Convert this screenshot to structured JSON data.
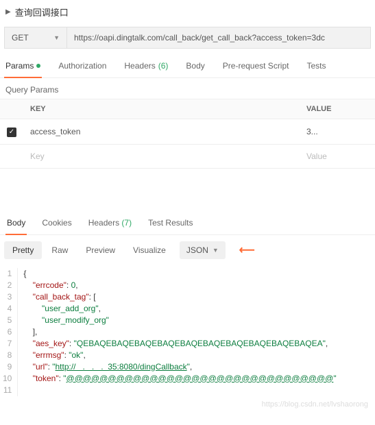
{
  "header": {
    "title": "查询回调接口"
  },
  "request": {
    "method": "GET",
    "url": "https://oapi.dingtalk.com/call_back/get_call_back?access_token=3dc"
  },
  "tabs": {
    "params": "Params",
    "auth": "Authorization",
    "headers": "Headers",
    "headers_count": "(6)",
    "body": "Body",
    "prerequest": "Pre-request Script",
    "tests": "Tests"
  },
  "query": {
    "title": "Query Params",
    "key_header": "KEY",
    "value_header": "VALUE",
    "rows": [
      {
        "checked": true,
        "key": "access_token",
        "value": "3..."
      }
    ],
    "key_placeholder": "Key",
    "value_placeholder": "Value"
  },
  "response": {
    "tabs": {
      "body": "Body",
      "cookies": "Cookies",
      "headers": "Headers",
      "headers_count": "(7)",
      "test_results": "Test Results"
    },
    "view": {
      "pretty": "Pretty",
      "raw": "Raw",
      "preview": "Preview",
      "visualize": "Visualize",
      "type": "JSON"
    },
    "body_json": {
      "errcode": 0,
      "call_back_tag": [
        "user_add_org",
        "user_modify_org"
      ],
      "aes_key": "QEBAQEBAQEBAQEBAQEBAQEBAQEBAQEBAQEBAQEBAQEA",
      "errmsg": "ok",
      "url": "http://   .   .   .  35:8080/dingCallback",
      "token": "@@@@@@@@@@@@@@@@@@@@@@@@@@@@@@@@"
    }
  },
  "watermark": "https://blog.csdn.net/lvshaorong"
}
